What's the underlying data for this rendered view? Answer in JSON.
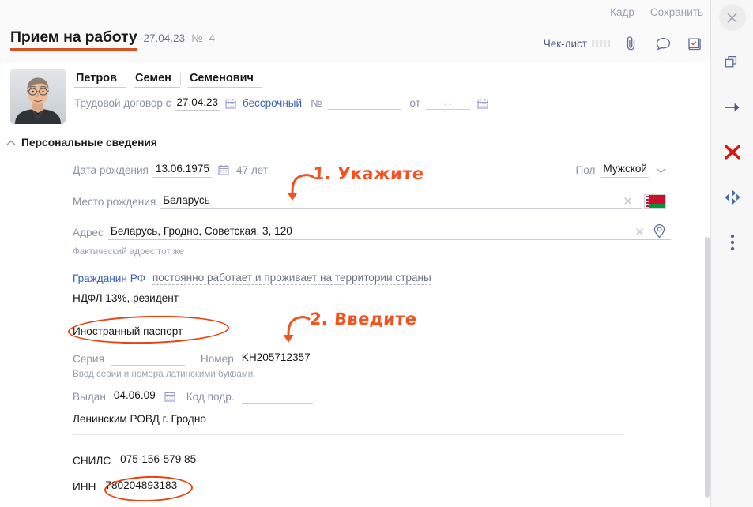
{
  "topbar": {
    "actions": [
      {
        "name": "frame",
        "label": "Кадр"
      },
      {
        "name": "save",
        "label": "Сохранить"
      }
    ]
  },
  "rail": {
    "items": [
      {
        "name": "close-icon",
        "label": "×"
      },
      {
        "name": "copy-icon",
        "label": ""
      },
      {
        "name": "arrow-right-icon",
        "label": ""
      },
      {
        "name": "delete-red-x-icon",
        "label": ""
      },
      {
        "name": "navigate-arrows-icon",
        "label": ""
      },
      {
        "name": "more-menu-icon",
        "label": ""
      }
    ]
  },
  "header": {
    "title": "Прием на работу",
    "date": "27.04.23",
    "number_label": "№",
    "number": "4",
    "checklist_label": "Чек-лист",
    "icons": [
      {
        "name": "attachment-paperclip-icon"
      },
      {
        "name": "comment-bubble-icon"
      },
      {
        "name": "task-scroll-check-icon"
      }
    ]
  },
  "person": {
    "last_name": "Петров",
    "first_name": "Семен",
    "middle_name": "Семенович",
    "contract_label": "Трудовой договор с",
    "contract_date": "27.04.23",
    "contract_type": "бессрочный",
    "contract_no_label": "№",
    "contract_no": "",
    "contract_from_label": "от",
    "contract_from_date": ". ."
  },
  "section": {
    "title": "Персональные сведения",
    "collapse_icon": "chevron-up-icon"
  },
  "fields": {
    "birth_date_label": "Дата рождения",
    "birth_date": "13.06.1975",
    "age": "47 лет",
    "gender_label": "Пол",
    "gender_value": "Мужской",
    "birth_place_label": "Место рождения",
    "birth_place": "Беларусь",
    "birth_place_flag": "belarus-flag-icon",
    "address_label": "Адрес",
    "address": "Беларусь, Гродно, Советская, 3, 120",
    "actual_address_note": "Фактический адрес тот же",
    "citizen_label": "Гражданин РФ",
    "citizen_status": "постоянно работает и проживает на территории страны",
    "tax_status": "НДФЛ 13%, резидент",
    "passport_type": "Иностранный паспорт",
    "series_label": "Серия",
    "series_value": "",
    "number_label": "Номер",
    "number_value": "KH205712357",
    "latin_hint": "Ввод серии и номера латинскими буквами",
    "issued_label": "Выдан",
    "issued_date": "04.06.09",
    "dept_code_label": "Код подр.",
    "dept_code_value": "",
    "issued_by": "Ленинским РОВД г. Гродно",
    "snils_label": "СНИЛС",
    "snils_value": "075-156-579 85",
    "inn_label": "ИНН",
    "inn_value": "780204893183"
  },
  "annotations": [
    {
      "name": "annotation-step-1",
      "text": "1. Укажите"
    },
    {
      "name": "annotation-step-2",
      "text": "2. Введите"
    }
  ],
  "colors": {
    "accent_orange": "#d94f22",
    "annotation_orange": "#f4511e",
    "link_blue": "#3a61b5",
    "label_gray": "#8b93a1"
  }
}
